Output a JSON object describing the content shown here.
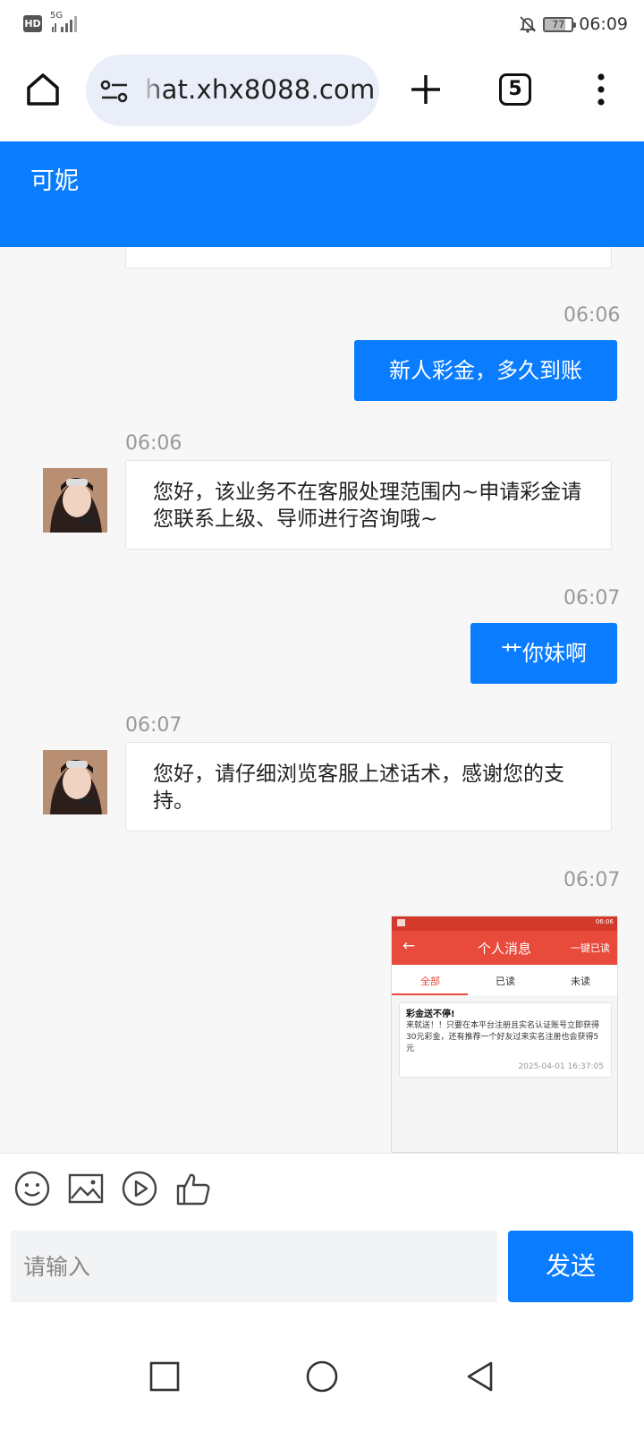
{
  "status_bar": {
    "hd": "HD",
    "network": "5G",
    "battery": "77",
    "time": "06:09"
  },
  "browser": {
    "url": "hat.xhx8088.com",
    "tab_count": "5",
    "icons": [
      "home-icon",
      "tune-icon",
      "plus-icon",
      "tabs-icon",
      "more-vert-icon"
    ]
  },
  "chat": {
    "title": "可妮",
    "messages": [
      {
        "side": "out",
        "time": "06:06",
        "text": "新人彩金，多久到账"
      },
      {
        "side": "in",
        "time": "06:06",
        "text": "您好，该业务不在客服处理范围内~申请彩金请您联系上级、导师进行咨询哦~"
      },
      {
        "side": "out",
        "time": "06:07",
        "text": "艹你妹啊"
      },
      {
        "side": "in",
        "time": "06:07",
        "text": "您好，请仔细浏览客服上述话术，感谢您的支持。"
      },
      {
        "side": "out",
        "time": "06:07",
        "type": "image"
      }
    ],
    "shot": {
      "status_time": "06:06",
      "title": "个人消息",
      "read_all": "一键已读",
      "back": "←",
      "tabs": [
        "全部",
        "已读",
        "未读"
      ],
      "card_title": "彩金送不停!",
      "card_body": "来就送！！只要在本平台注册且实名认证账号立即获得30元彩金，还有推荐一个好友过来实名注册也会获得5元",
      "card_time": "2025-04-01 16:37:05"
    }
  },
  "input": {
    "placeholder": "请输入",
    "send_label": "发送",
    "tools": [
      "emoji-icon",
      "image-icon",
      "video-icon",
      "thumbs-up-icon"
    ]
  },
  "nav": [
    "recent-apps-icon",
    "home-circle-icon",
    "back-triangle-icon"
  ],
  "colors": {
    "accent": "#0a7cff",
    "shot_red": "#e84a3c"
  }
}
